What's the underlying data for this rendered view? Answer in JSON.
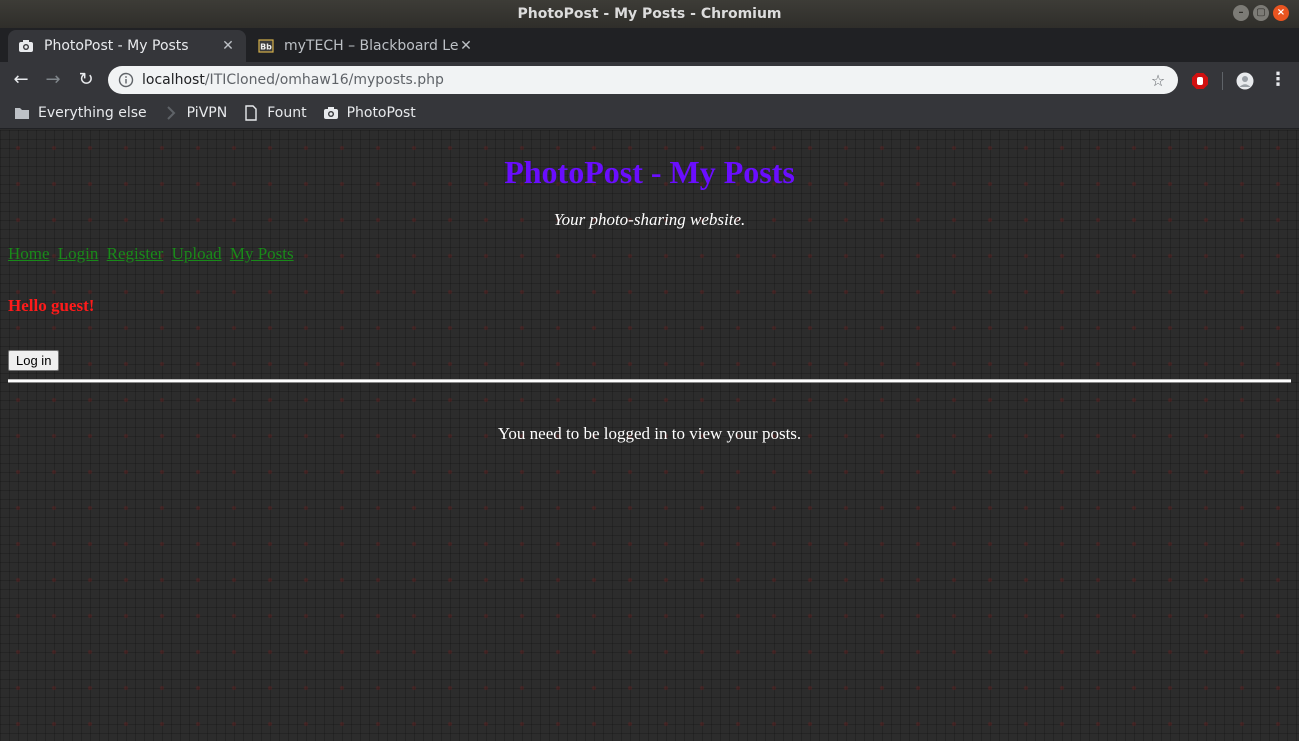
{
  "window": {
    "title": "PhotoPost - My Posts - Chromium",
    "controls": [
      "–",
      "▢",
      "×"
    ]
  },
  "tabs": [
    {
      "label": "PhotoPost - My Posts",
      "icon": "camera-icon",
      "active": true
    },
    {
      "label": "myTECH – Blackboard Lea",
      "icon": "blackboard-icon",
      "active": false
    }
  ],
  "toolbar": {
    "back": "←",
    "forward": "→",
    "reload": "↻",
    "url_host": "localhost",
    "url_path": "/ITICloned/omhaw16/myposts.php",
    "star": "☆",
    "menu": "⋮"
  },
  "bookmarks": [
    {
      "label": "Everything else",
      "icon": "folder-icon"
    },
    {
      "label": "PiVPN",
      "icon": "pivpn-icon"
    },
    {
      "label": "Fount",
      "icon": "page-icon"
    },
    {
      "label": "PhotoPost",
      "icon": "camera-icon"
    }
  ],
  "page": {
    "title": "PhotoPost - My Posts",
    "tagline": "Your photo-sharing website.",
    "nav": [
      "Home",
      "Login",
      "Register",
      "Upload",
      "My Posts"
    ],
    "greeting": "Hello guest!",
    "login_button": "Log in",
    "message": "You need to be logged in to view your posts."
  },
  "colors": {
    "title": "#6a0dff",
    "nav_link": "#198a19",
    "greeting": "#ff1a1a"
  }
}
